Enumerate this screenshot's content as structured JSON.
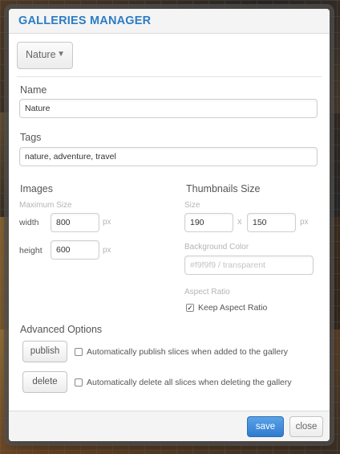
{
  "dialog": {
    "title": "GALLERIES MANAGER",
    "gallery_select_value": "Nature"
  },
  "name_section": {
    "label": "Name",
    "value": "Nature"
  },
  "tags_section": {
    "label": "Tags",
    "value": "nature, adventure,  travel"
  },
  "images": {
    "label": "Images",
    "max_size_label": "Maximum Size",
    "width_label": "width",
    "width_value": "800",
    "height_label": "height",
    "height_value": "600",
    "unit": "px"
  },
  "thumbnails": {
    "label": "Thumbnails Size",
    "size_label": "Size",
    "width_value": "190",
    "separator": "x",
    "height_value": "150",
    "unit": "px",
    "bg_color_label": "Background Color",
    "bg_color_placeholder": "#f9f9f9 / transparent",
    "aspect_label": "Aspect Ratio",
    "keep_aspect_label": "Keep Aspect Ratio",
    "keep_aspect_checked": true
  },
  "advanced": {
    "label": "Advanced Options",
    "publish_button": "publish",
    "publish_desc": "Automatically publish slices when added to the gallery",
    "publish_checked": false,
    "delete_button": "delete",
    "delete_desc": "Automatically delete all slices when deleting the gallery",
    "delete_checked": false
  },
  "footer": {
    "save_label": "save",
    "close_label": "close"
  },
  "colors": {
    "title_blue": "#2d7cc4",
    "primary_button": "#3a86d6"
  },
  "icons": {
    "dropdown": "chevron-down-icon",
    "checkmark": "check-icon"
  }
}
